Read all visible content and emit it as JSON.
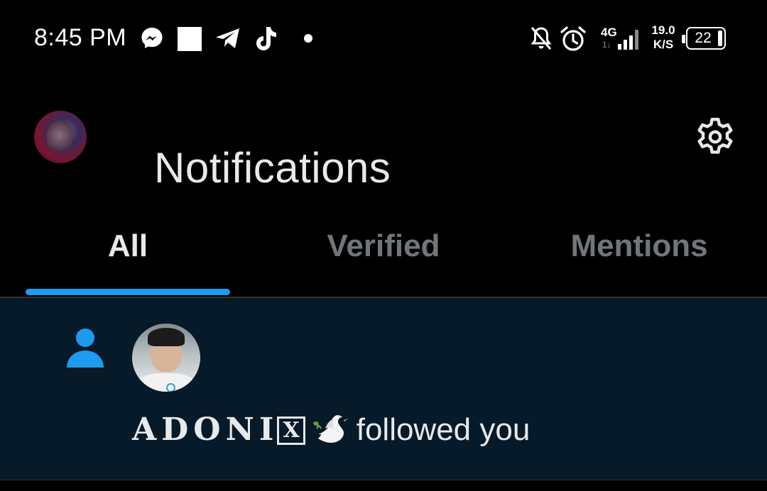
{
  "status_bar": {
    "time": "8:45 PM",
    "notification_icons": [
      "messenger-icon",
      "square-icon",
      "telegram-icon",
      "tiktok-icon",
      "dot-icon"
    ],
    "system_icons": [
      "bell-off-icon",
      "alarm-icon",
      "signal-icon"
    ],
    "network_type": "4G",
    "network_sub": "1↓",
    "speed_value": "19.0",
    "speed_unit": "K/S",
    "battery_percent": "22"
  },
  "header": {
    "title": "Notifications",
    "settings_icon": "gear-icon"
  },
  "tabs": [
    {
      "label": "All",
      "active": true
    },
    {
      "label": "Verified",
      "active": false
    },
    {
      "label": "Mentions",
      "active": false
    }
  ],
  "notifications": [
    {
      "type_icon": "person-icon",
      "user_name": "ADONI",
      "user_name_suffix": "X",
      "emoji": "dove-icon",
      "action": "followed you"
    }
  ],
  "colors": {
    "accent": "#1d9bf0",
    "background": "#000000",
    "notification_bg": "#061a2a",
    "text_primary": "#e7e9ea",
    "text_secondary": "#71767b"
  }
}
